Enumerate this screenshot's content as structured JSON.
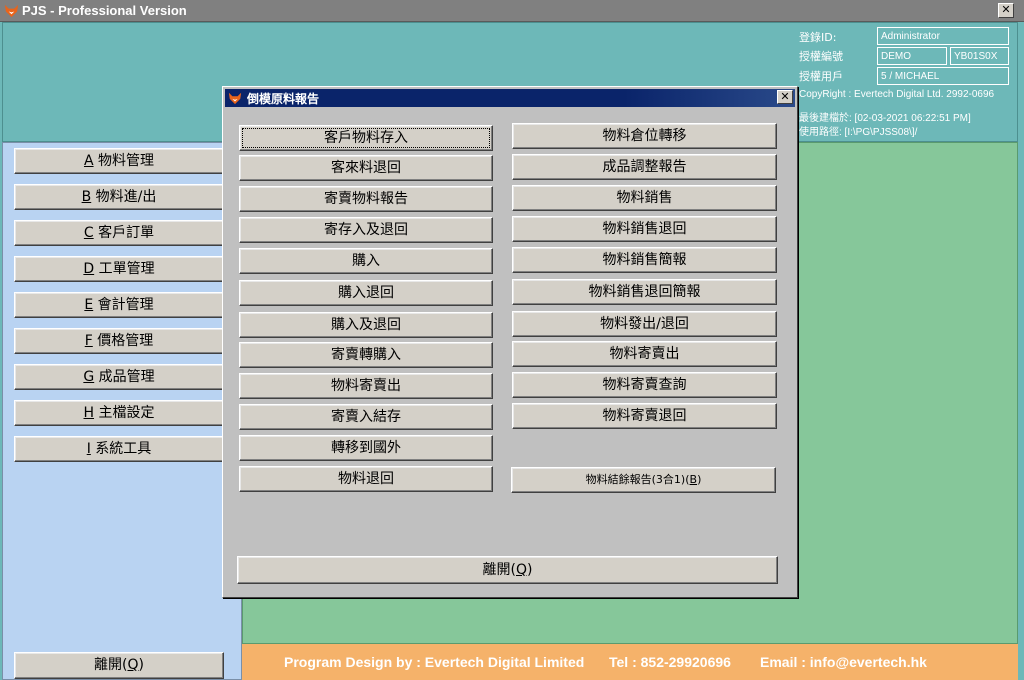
{
  "window": {
    "title": "PJS - Professional Version",
    "close": "✕"
  },
  "header": {
    "login_label": "登錄ID:",
    "login_value": "Administrator",
    "license_no_label": "授權編號",
    "license_no_value1": "DEMO",
    "license_no_value2": "YB01S0X",
    "license_user_label": "授權用戶",
    "license_user_value": "5 / MICHAEL",
    "copyright": "CopyRight : Evertech Digital Ltd. 2992-0696",
    "last_build": "最後建檔於: [02-03-2021 06:22:51 PM]",
    "path": "使用路徑: [I:\\PG\\PJSS08\\]/"
  },
  "menu": {
    "items": [
      {
        "key": "A",
        "label": "物料管理"
      },
      {
        "key": "B",
        "label": "物料進/出"
      },
      {
        "key": "C",
        "label": "客戶訂單"
      },
      {
        "key": "D",
        "label": "工單管理"
      },
      {
        "key": "E",
        "label": "會計管理"
      },
      {
        "key": "F",
        "label": "價格管理"
      },
      {
        "key": "G",
        "label": "成品管理"
      },
      {
        "key": "H",
        "label": "主檔設定"
      },
      {
        "key": "I",
        "label": "系統工具"
      }
    ],
    "exit_label": "離開(",
    "exit_key": "Q",
    "exit_tail": ")"
  },
  "footer": {
    "design": "Program Design by : Evertech Digital Limited",
    "tel": "Tel : 852-29920696",
    "email": "Email : info@evertech.hk"
  },
  "dialog": {
    "title": "倒模原料報告",
    "close": "✕",
    "left_buttons": [
      "客戶物料存入",
      "客來料退回",
      "寄賣物料報告",
      "寄存入及退回",
      "購入",
      "購入退回",
      "購入及退回",
      "寄賣轉購入",
      "物料寄賣出",
      "寄賣入結存",
      "轉移到國外",
      "物料退回"
    ],
    "right_buttons": [
      "物料倉位轉移",
      "成品調整報告",
      "物料銷售",
      "物料銷售退回",
      "物料銷售簡報",
      "物料銷售退回簡報",
      "物料發出/退回",
      "物料寄賣出",
      "物料寄賣查詢",
      "物料寄賣退回"
    ],
    "summary_label": "物料結餘報告(3合1)(",
    "summary_key": "B",
    "summary_tail": ")",
    "exit_label": "離開(",
    "exit_key": "Q",
    "exit_tail": ")"
  },
  "colors": {
    "header_bg": "#6db8b8",
    "left_bg": "#b9d3f2",
    "right_bg": "#86c79a",
    "footer_bg": "#f5b26a",
    "dialog_title_bg": "#0a246a"
  }
}
